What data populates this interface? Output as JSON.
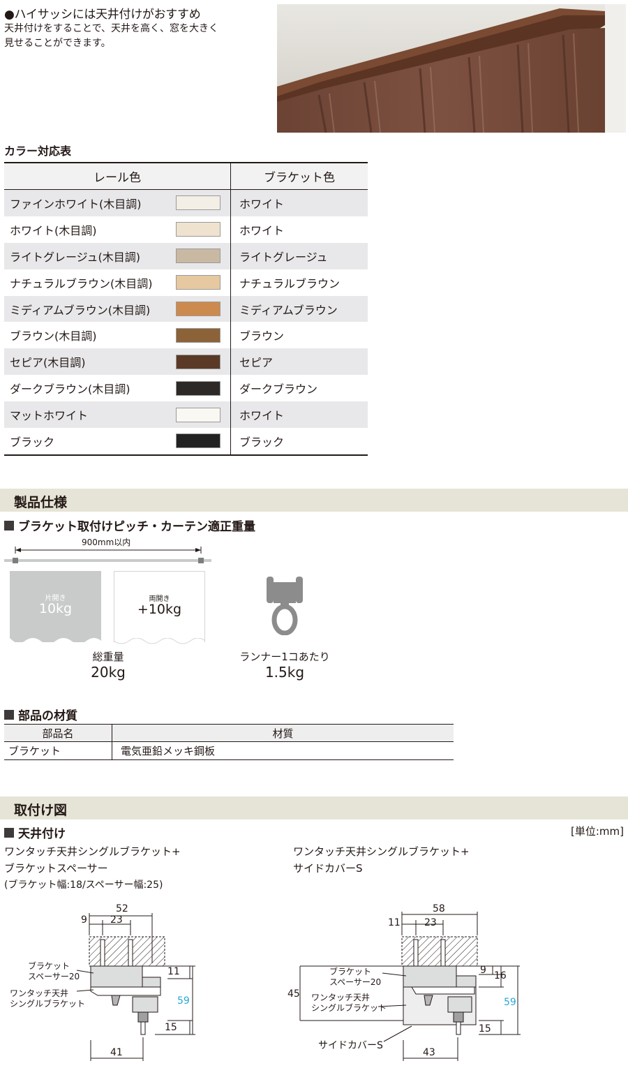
{
  "intro": {
    "heading": "●ハイサッシには天井付けがおすすめ",
    "body_line1": "天井付けをすることで、天井を高く、窓を大きく",
    "body_line2": "見せることができます。"
  },
  "color_table": {
    "title": "カラー対応表",
    "col_rail": "レール色",
    "col_bracket": "ブラケット色",
    "rows": [
      {
        "rail": "ファインホワイト(木目調)",
        "swatch": "#f3efe6",
        "bracket": "ホワイト"
      },
      {
        "rail": "ホワイト(木目調)",
        "swatch": "#efe3cf",
        "bracket": "ホワイト"
      },
      {
        "rail": "ライトグレージュ(木目調)",
        "swatch": "#c9b9a3",
        "bracket": "ライトグレージュ"
      },
      {
        "rail": "ナチュラルブラウン(木目調)",
        "swatch": "#e6c9a0",
        "bracket": "ナチュラルブラウン"
      },
      {
        "rail": "ミディアムブラウン(木目調)",
        "swatch": "#cd8a4e",
        "bracket": "ミディアムブラウン"
      },
      {
        "rail": "ブラウン(木目調)",
        "swatch": "#8c6239",
        "bracket": "ブラウン"
      },
      {
        "rail": "セピア(木目調)",
        "swatch": "#5a3a26",
        "bracket": "セピア"
      },
      {
        "rail": "ダークブラウン(木目調)",
        "swatch": "#2d2926",
        "bracket": "ダークブラウン"
      },
      {
        "rail": "マットホワイト",
        "swatch": "#faf8f2",
        "bracket": "ホワイト"
      },
      {
        "rail": "ブラック",
        "swatch": "#222222",
        "bracket": "ブラック"
      }
    ]
  },
  "spec": {
    "section_title": "製品仕様",
    "sub_title": "ブラケット取付けピッチ・カーテン適正重量",
    "width_label": "900mm以内",
    "panel_one_small": "片開き",
    "panel_one_big": "10kg",
    "panel_two_small": "両開き",
    "panel_two_big": "+10kg",
    "total_label": "総重量",
    "total_value": "20kg",
    "runner_label": "ランナー1コあたり",
    "runner_value": "1.5kg"
  },
  "materials": {
    "sub_title": "部品の材質",
    "col_part": "部品名",
    "col_material": "材質",
    "rows": [
      {
        "part": "ブラケット",
        "material": "電気亜鉛メッキ鋼板"
      }
    ]
  },
  "install": {
    "section_title": "取付け図",
    "sub_title": "天井付け",
    "unit": "[単位:mm]",
    "left": {
      "caption1": "ワンタッチ天井シングルブラケット+",
      "caption2": "ブラケットスペーサー",
      "note": "(ブラケット幅:18/スペーサー幅:25)",
      "dims": {
        "w52": "52",
        "d9": "9",
        "d23": "23",
        "d11": "11",
        "d59": "59",
        "d15": "15",
        "d41": "41"
      },
      "label_spacer1": "ブラケット",
      "label_spacer2": "スペーサー20",
      "label_bracket1": "ワンタッチ天井",
      "label_bracket2": "シングルブラケット"
    },
    "right": {
      "caption1": "ワンタッチ天井シングルブラケット+",
      "caption2": "サイドカバーS",
      "dims": {
        "w58": "58",
        "d11": "11",
        "d23": "23",
        "d9": "9",
        "d16": "16",
        "d45": "45",
        "d59": "59",
        "d15": "15",
        "d43": "43"
      },
      "label_spacer1": "ブラケット",
      "label_spacer2": "スペーサー20",
      "label_bracket1": "ワンタッチ天井",
      "label_bracket2": "シングルブラケット",
      "label_cover": "サイドカバーS"
    }
  }
}
